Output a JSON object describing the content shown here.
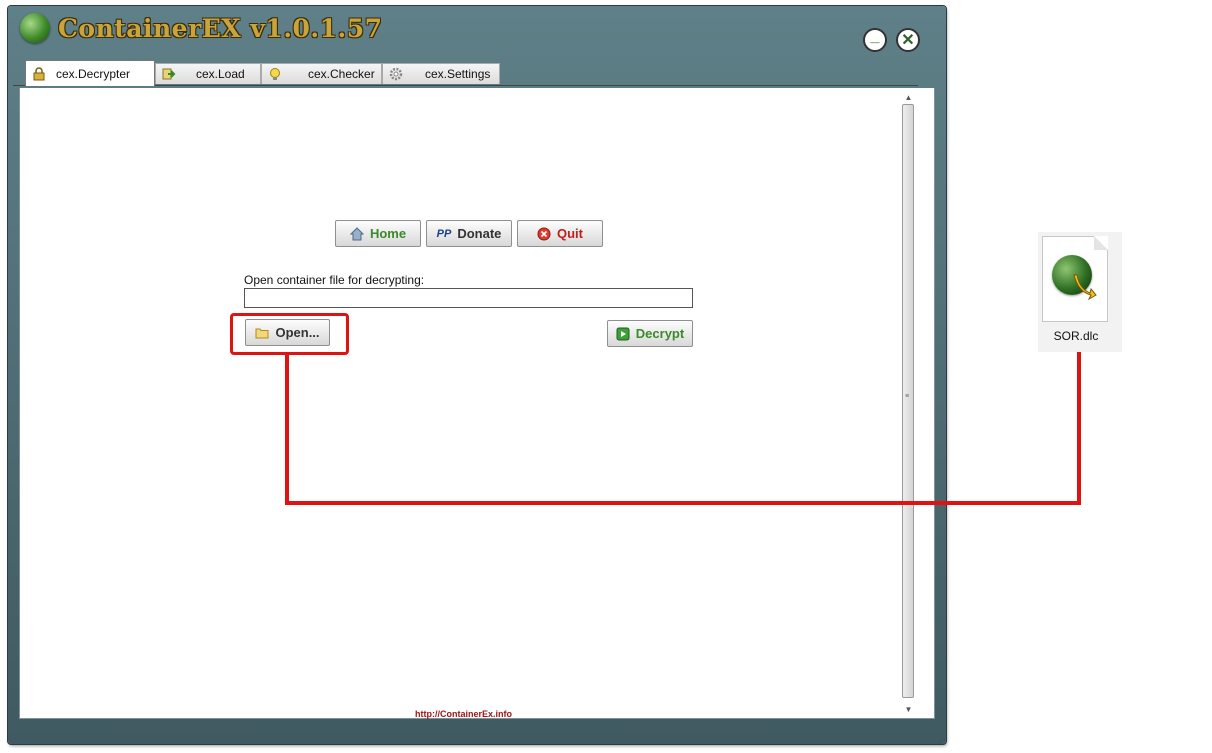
{
  "window": {
    "title": "ContainerEX v1.0.1.57",
    "minimize_label": "_",
    "close_label": "✕"
  },
  "tabs": [
    {
      "label": "cex.Decrypter",
      "icon": "lock-icon",
      "active": true
    },
    {
      "label": "cex.Load",
      "icon": "arrow-load-icon",
      "active": false
    },
    {
      "label": "cex.Checker",
      "icon": "lightbulb-icon",
      "active": false
    },
    {
      "label": "cex.Settings",
      "icon": "gear-icon",
      "active": false
    }
  ],
  "top_buttons": {
    "home": "Home",
    "donate": "Donate",
    "quit": "Quit"
  },
  "open_section": {
    "label": "Open container file for decrypting:",
    "field_value": "",
    "open_button": "Open...",
    "decrypt_button": "Decrypt"
  },
  "footer": {
    "link": "http://ContainerEx.info"
  },
  "desktop_file": {
    "name": "SOR.dlc",
    "icon": "dlc-file-icon"
  },
  "colors": {
    "home": "#3a8a2a",
    "quit": "#c0201b",
    "decrypt": "#3a8a2a",
    "donate": "#333333",
    "annotation": "#e01313",
    "link": "#9b1414"
  }
}
